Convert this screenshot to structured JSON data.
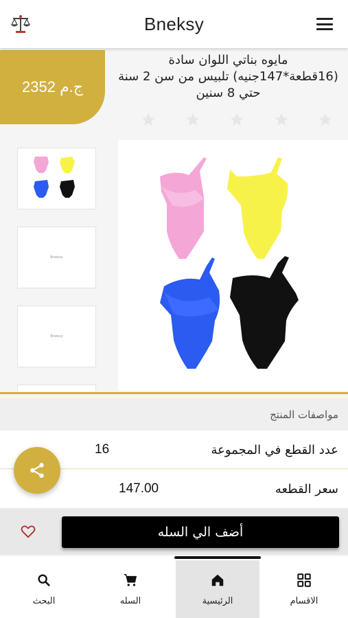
{
  "header": {
    "brand": "Bneksy",
    "logo_icon": "scales-icon",
    "menu_icon": "hamburger-menu-icon"
  },
  "product": {
    "price": "2352 ج.م",
    "title": "مايوه بناتي  اللوان سادة (16قطعة*147جنيه) تلبيس من سن 2 سنة حتي 8 سنين",
    "rating_stars": 5,
    "thumbnails": [
      {
        "type": "image",
        "alt": ""
      },
      {
        "type": "placeholder",
        "text": "Bneksy"
      },
      {
        "type": "placeholder",
        "text": "Bneksy"
      }
    ]
  },
  "specs": {
    "title": "مواصفات المنتج",
    "rows": [
      {
        "label": "عدد القطع في المجموعة",
        "value": "16"
      },
      {
        "label": "سعر القطعه",
        "value": "147.00"
      }
    ]
  },
  "actions": {
    "add_to_cart": "أضف الي السله",
    "favorite_icon": "heart-icon",
    "share_icon": "share-icon"
  },
  "bottom_nav": {
    "items": [
      {
        "label": "البحث",
        "icon": "search-icon"
      },
      {
        "label": "السله",
        "icon": "cart-icon"
      },
      {
        "label": "الرئيسية",
        "icon": "home-icon",
        "active": true
      },
      {
        "label": "الاقسام",
        "icon": "grid-icon"
      }
    ]
  },
  "colors": {
    "accent": "#d1b03f",
    "button": "#000000"
  }
}
